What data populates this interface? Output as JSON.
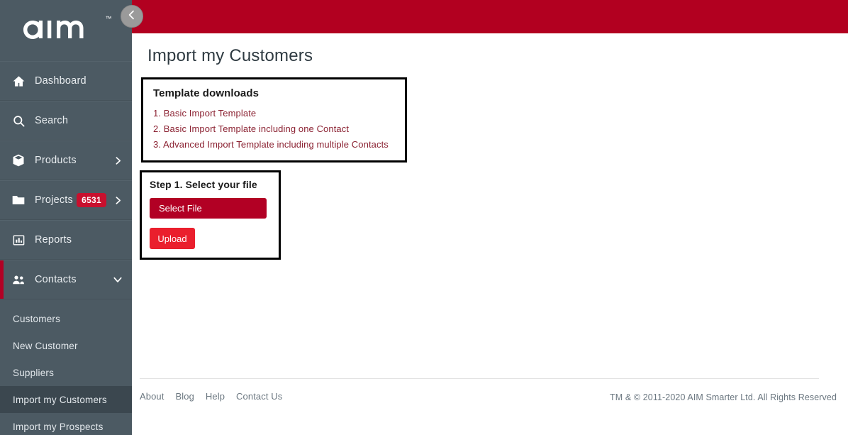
{
  "brand": {
    "logo_text": "aim",
    "logo_tm": "™",
    "sidebar_color": "#4c5a63",
    "accent_red": "#b20020",
    "bright_red": "#ea1f2d"
  },
  "topbar": {
    "collapse_icon": "chevron-left-icon"
  },
  "sidebar": {
    "items": [
      {
        "label": "Dashboard",
        "icon": "home-icon",
        "badge": null,
        "arrow": null,
        "active": false
      },
      {
        "label": "Search",
        "icon": "search-icon",
        "badge": null,
        "arrow": null,
        "active": false
      },
      {
        "label": "Products",
        "icon": "box-icon",
        "badge": null,
        "arrow": "chevron-right-icon",
        "active": false
      },
      {
        "label": "Projects",
        "icon": "folder-icon",
        "badge": "6531",
        "arrow": "chevron-right-icon",
        "active": false
      },
      {
        "label": "Reports",
        "icon": "bar-chart-icon",
        "badge": null,
        "arrow": null,
        "active": false
      },
      {
        "label": "Contacts",
        "icon": "people-icon",
        "badge": null,
        "arrow": "chevron-down-icon",
        "active": true
      }
    ],
    "subitems": [
      {
        "label": "Customers",
        "active": false
      },
      {
        "label": "New Customer",
        "active": false
      },
      {
        "label": "Suppliers",
        "active": false
      },
      {
        "label": "Import my Customers",
        "active": true
      },
      {
        "label": "Import my Prospects",
        "active": false
      }
    ]
  },
  "main": {
    "page_title": "Import my Customers",
    "templates_panel": {
      "title": "Template downloads",
      "links": [
        {
          "num": "1.",
          "label": "Basic Import Template"
        },
        {
          "num": "2.",
          "label": "Basic Import Template including one Contact"
        },
        {
          "num": "3.",
          "label": "Advanced Import Template including multiple Contacts"
        }
      ]
    },
    "step_panel": {
      "title": "Step 1. Select your file",
      "select_file_label": "Select File",
      "upload_label": "Upload"
    }
  },
  "footer": {
    "links": [
      "About",
      "Blog",
      "Help",
      "Contact Us"
    ],
    "copyright": "TM & © 2011-2020 AIM Smarter Ltd. All Rights Reserved"
  }
}
